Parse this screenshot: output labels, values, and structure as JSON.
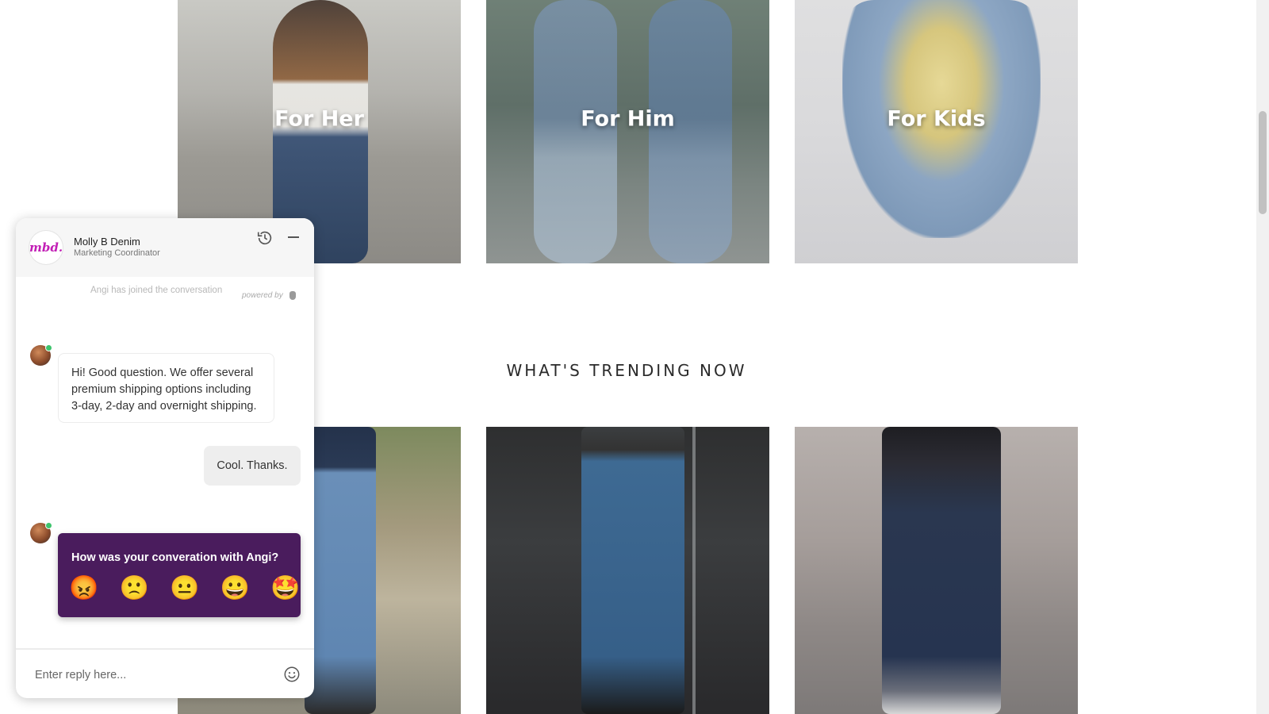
{
  "categories": {
    "her": "For Her",
    "him": "For Him",
    "kids": "For Kids"
  },
  "trending": {
    "title": "WHAT'S TRENDING NOW"
  },
  "chat": {
    "brand_logo_text": "mbd.",
    "agent_name": "Molly B Denim",
    "agent_title": "Marketing Coordinator",
    "joined_notice": "Angi has joined the conversation",
    "powered_by": "powered by",
    "messages": [
      {
        "from": "agent",
        "text": "Hi! Good question. We offer several premium shipping options including 3-day, 2-day and overnight shipping."
      },
      {
        "from": "user",
        "text": "Cool. Thanks."
      }
    ],
    "rating_question": "How was your converation with Angi?",
    "rating_emojis": [
      "😡",
      "🙁",
      "😐",
      "😀",
      "🤩"
    ],
    "reply_placeholder": "Enter reply here..."
  },
  "colors": {
    "rating_bg": "#4a1c5d",
    "brand_accent": "#c21fb5",
    "online_dot": "#3ec46d"
  }
}
